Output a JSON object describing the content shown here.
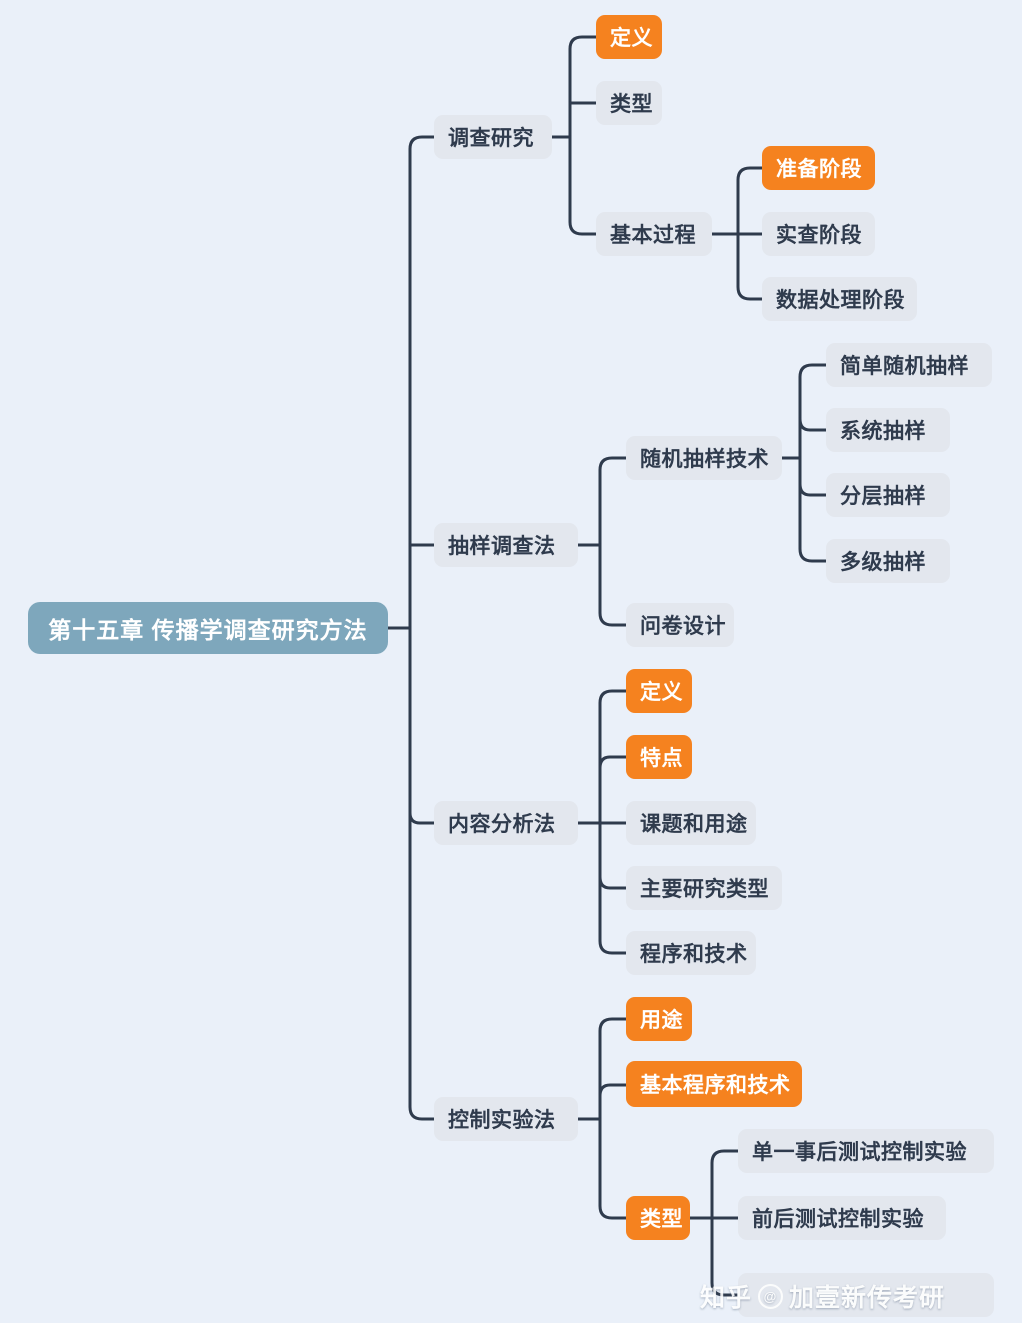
{
  "diagram": {
    "type": "mindmap",
    "orientation": "left-to-right",
    "background_color": "#eaf0f9",
    "edge_color": "#2f3b4d",
    "root_color": "#7ea7bc",
    "node_gray_color": "#e3e7ee",
    "node_highlight_color": "#f5821f",
    "text_dark_color": "#2f3b4d",
    "text_light_color": "#ffffff"
  },
  "root": {
    "label": "第十五章 传播学调查研究方法",
    "style": "root"
  },
  "branches": [
    {
      "label": "调查研究",
      "style": "gray",
      "children": [
        {
          "label": "定义",
          "style": "orange",
          "children": []
        },
        {
          "label": "类型",
          "style": "gray",
          "children": []
        },
        {
          "label": "基本过程",
          "style": "gray",
          "children": [
            {
              "label": "准备阶段",
              "style": "orange"
            },
            {
              "label": "实查阶段",
              "style": "gray"
            },
            {
              "label": "数据处理阶段",
              "style": "gray"
            }
          ]
        }
      ]
    },
    {
      "label": "抽样调查法",
      "style": "gray",
      "children": [
        {
          "label": "随机抽样技术",
          "style": "gray",
          "children": [
            {
              "label": "简单随机抽样",
              "style": "gray"
            },
            {
              "label": "系统抽样",
              "style": "gray"
            },
            {
              "label": "分层抽样",
              "style": "gray"
            },
            {
              "label": "多级抽样",
              "style": "gray"
            }
          ]
        },
        {
          "label": "问卷设计",
          "style": "gray",
          "children": []
        }
      ]
    },
    {
      "label": "内容分析法",
      "style": "gray",
      "children": [
        {
          "label": "定义",
          "style": "orange",
          "children": []
        },
        {
          "label": "特点",
          "style": "orange",
          "children": []
        },
        {
          "label": "课题和用途",
          "style": "gray",
          "children": []
        },
        {
          "label": "主要研究类型",
          "style": "gray",
          "children": []
        },
        {
          "label": "程序和技术",
          "style": "gray",
          "children": []
        }
      ]
    },
    {
      "label": "控制实验法",
      "style": "gray",
      "children": [
        {
          "label": "用途",
          "style": "orange",
          "children": []
        },
        {
          "label": "基本程序和技术",
          "style": "orange",
          "children": []
        },
        {
          "label": "类型",
          "style": "orange",
          "children": [
            {
              "label": "单一事后测试控制实验",
              "style": "gray"
            },
            {
              "label": "前后测试控制实验",
              "style": "gray"
            },
            {
              "label": "",
              "style": "gray"
            }
          ]
        }
      ]
    }
  ],
  "watermark": {
    "site": "知乎",
    "at": "@",
    "handle": "加壹新传考研"
  }
}
